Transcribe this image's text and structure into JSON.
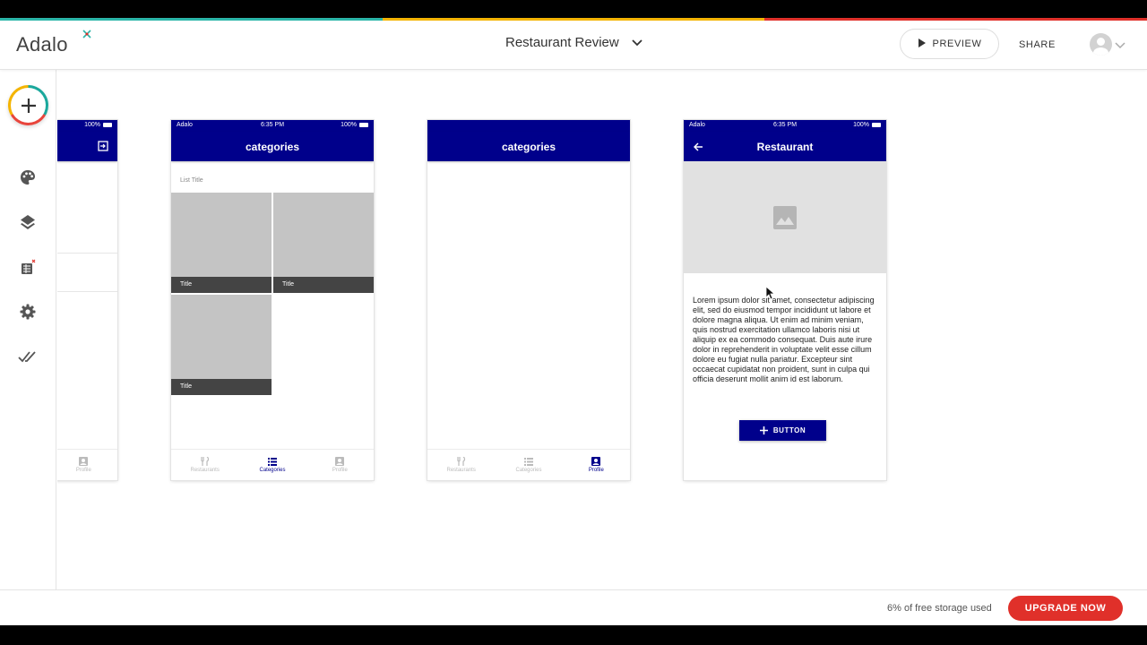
{
  "brand": {
    "logo_text": "Adalo",
    "strip_colors": [
      "#2bb5a8",
      "#f4b400",
      "#e0302a"
    ]
  },
  "header": {
    "project_title": "Restaurant Review",
    "preview_label": "PREVIEW",
    "share_label": "SHARE"
  },
  "sidebar": {
    "items": [
      {
        "name": "add-component",
        "icon": "plus-icon"
      },
      {
        "name": "branding",
        "icon": "palette-icon"
      },
      {
        "name": "screens-layers",
        "icon": "layers-icon"
      },
      {
        "name": "database",
        "icon": "database-icon"
      },
      {
        "name": "settings",
        "icon": "gear-icon"
      },
      {
        "name": "publish",
        "icon": "double-check-icon"
      }
    ]
  },
  "screens": {
    "partial": {
      "battery": "100%"
    },
    "categories_list": {
      "carrier": "Adalo",
      "time": "6:35 PM",
      "battery": "100%",
      "title": "categories",
      "list_title": "List Title",
      "tiles": [
        "Title",
        "Title",
        "Title"
      ]
    },
    "categories_empty": {
      "title": "categories"
    },
    "restaurant": {
      "carrier": "Adalo",
      "time": "6:35 PM",
      "battery": "100%",
      "title": "Restaurant",
      "paragraph": "Lorem ipsum dolor sit amet, consectetur adipiscing elit, sed do eiusmod tempor incididunt ut labore et dolore magna aliqua. Ut enim ad minim veniam, quis nostrud exercitation ullamco laboris nisi ut aliquip ex ea commodo consequat. Duis aute irure dolor in reprehenderit in voluptate velit esse cillum dolore eu fugiat nulla pariatur. Excepteur sint occaecat cupidatat non proident, sunt in culpa qui officia deserunt mollit anim id est laborum.",
      "button_label": "BUTTON"
    }
  },
  "tabs": {
    "restaurants": "Restaurants",
    "categories": "Categories",
    "profile": "Profile"
  },
  "footer": {
    "storage_text": "6% of free storage used",
    "upgrade_label": "UPGRADE NOW"
  },
  "colors": {
    "app_bar": "#00008b",
    "upgrade": "#e0302a"
  }
}
